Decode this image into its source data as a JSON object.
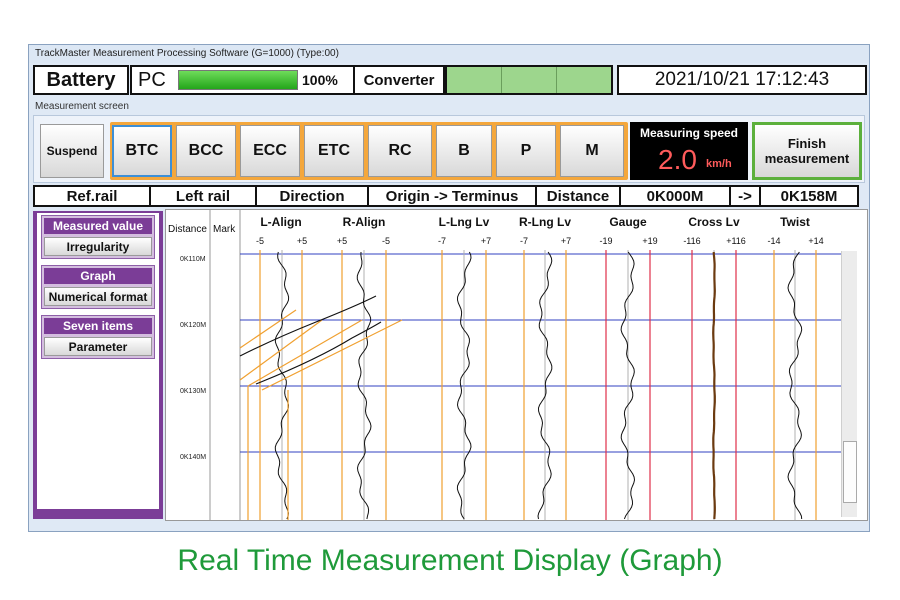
{
  "window": {
    "title": "TrackMaster Measurement Processing Software (G=1000)  (Type:00)"
  },
  "status": {
    "battery_label": "Battery",
    "pc_label": "PC",
    "pc_level": 100,
    "pc_percent": "100%",
    "converter_label": "Converter",
    "datetime": "2021/10/21 17:12:43"
  },
  "screen": {
    "section_label": "Measurement screen",
    "suspend_label": "Suspend",
    "modes": [
      "BTC",
      "BCC",
      "ECC",
      "ETC",
      "RC",
      "B",
      "P",
      "M"
    ],
    "active_mode": "BTC",
    "speed_title": "Measuring speed",
    "speed_value": "2.0",
    "speed_unit": "km/h",
    "finish_line1": "Finish",
    "finish_line2": "measurement"
  },
  "info": {
    "refrail_label": "Ref.rail",
    "refrail_value": "Left rail",
    "direction_label": "Direction",
    "direction_value": "Origin -> Terminus",
    "distance_label": "Distance",
    "distance_from": "0K000M",
    "arrow": "->",
    "distance_to": "0K158M"
  },
  "side_menu": [
    {
      "header": "Measured value",
      "button": "Irregularity"
    },
    {
      "header": "Graph",
      "button": "Numerical format"
    },
    {
      "header": "Seven items",
      "button": "Parameter"
    }
  ],
  "graph": {
    "distance_header": "Distance",
    "mark_header": "Mark",
    "distance_ticks": [
      "0K110M",
      "0K120M",
      "0K130M",
      "0K140M"
    ],
    "channels": [
      {
        "name": "L-Align",
        "min": "-5",
        "max": "+5"
      },
      {
        "name": "R-Align",
        "min": "+5",
        "max": "-5"
      },
      {
        "name": "L-Lng Lv",
        "min": "-7",
        "max": "+7"
      },
      {
        "name": "R-Lng Lv",
        "min": "-7",
        "max": "+7"
      },
      {
        "name": "Gauge",
        "min": "-19",
        "max": "+19"
      },
      {
        "name": "Cross Lv",
        "min": "-116",
        "max": "+116"
      },
      {
        "name": "Twist",
        "min": "-14",
        "max": "+14"
      }
    ]
  },
  "colors": {
    "accent_orange": "#f4a73c",
    "limit_line": "#f0a030",
    "gauge_limit": "#e0304a",
    "distance_grid": "#3040c0",
    "trace": "#111111",
    "menu_purple": "#7b3d97",
    "caption_green": "#1f9a3a"
  },
  "caption": "Real Time Measurement Display (Graph)"
}
